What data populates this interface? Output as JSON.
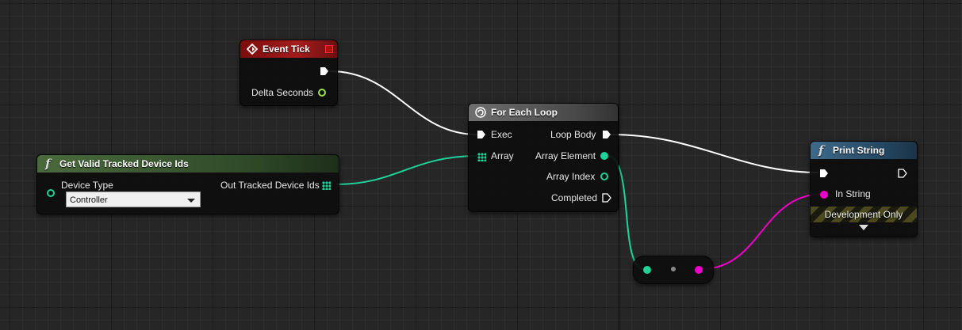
{
  "nodes": {
    "event_tick": {
      "title": "Event Tick",
      "pins": {
        "delta_seconds": "Delta Seconds"
      }
    },
    "get_valid_tracked_device_ids": {
      "title": "Get Valid Tracked Device Ids",
      "pins": {
        "device_type_label": "Device Type",
        "device_type_value": "Controller",
        "out_ids": "Out Tracked Device Ids"
      }
    },
    "for_each_loop": {
      "title": "For Each Loop",
      "pins": {
        "exec": "Exec",
        "array": "Array",
        "loop_body": "Loop Body",
        "array_element": "Array Element",
        "array_index": "Array Index",
        "completed": "Completed"
      }
    },
    "print_string": {
      "title": "Print String",
      "pins": {
        "in_string": "In String"
      },
      "dev_only": "Development Only"
    }
  },
  "colors": {
    "exec_wire": "#ffffff",
    "int_pin": "#1ed29a",
    "string_pin": "#f000c8",
    "float_pin": "#9be04a"
  },
  "icons": [
    "event-diamond-icon",
    "function-icon",
    "loop-icon",
    "exec-pin-icon",
    "array-grid-icon",
    "expand-arrow-icon"
  ]
}
